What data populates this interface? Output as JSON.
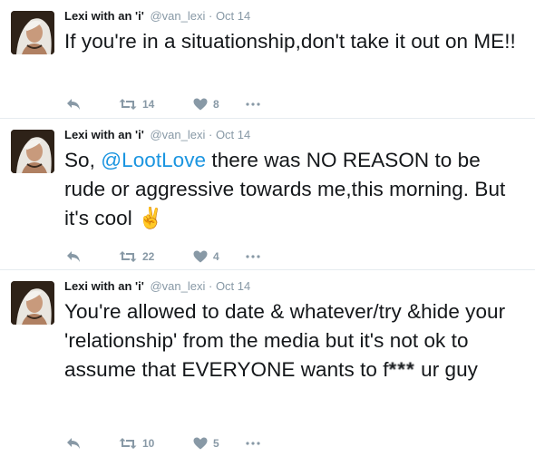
{
  "colors": {
    "mention": "#1b95e0",
    "secondary_text": "#8899a6",
    "divider": "#e6ecf0"
  },
  "icons": {
    "reply": "reply-icon",
    "retweet": "retweet-icon",
    "like": "heart-icon",
    "more": "more-icon"
  },
  "tweets": [
    {
      "name": "Lexi with an 'i'",
      "handle": "@van_lexi",
      "separator": "·",
      "time": "Oct 14",
      "text": "If you're in a situationship,don't take it out on ME!!",
      "retweets": "14",
      "likes": "8"
    },
    {
      "name": "Lexi with an 'i'",
      "handle": "@van_lexi",
      "separator": "·",
      "time": "Oct 14",
      "text_before": "So, ",
      "mention": "@LootLove",
      "text_after": " there was NO REASON to be rude or aggressive towards me,this morning. But it's cool ",
      "emoji": "✌",
      "retweets": "22",
      "likes": "4"
    },
    {
      "name": "Lexi with an 'i'",
      "handle": "@van_lexi",
      "separator": "·",
      "time": "Oct 14",
      "text_before": "You're allowed to date & whatever/try &hide your 'relationship' from the media but it's not ok to assume that EVERYONE wants to f",
      "censored": "***",
      "text_after": " ur guy",
      "retweets": "10",
      "likes": "5"
    }
  ]
}
